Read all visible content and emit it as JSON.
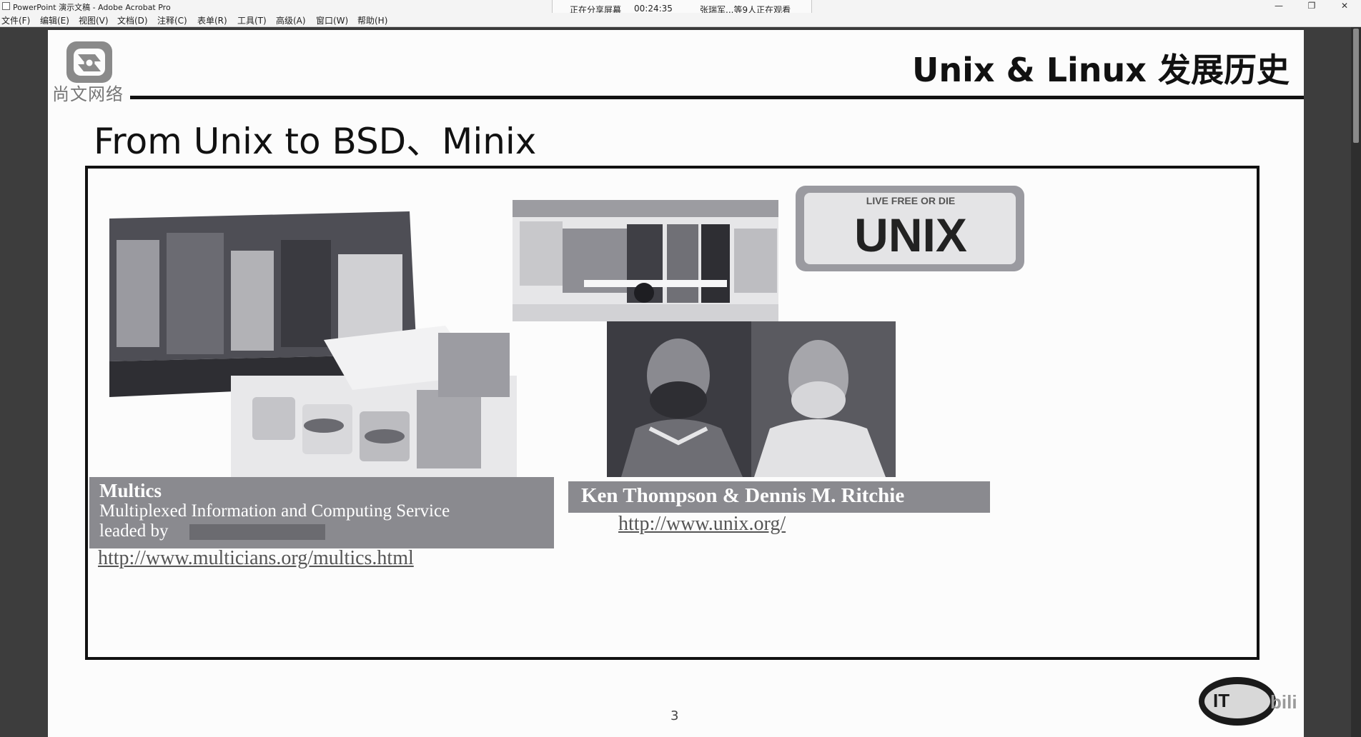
{
  "window": {
    "title": "PowerPoint 演示文稿 - Adobe Acrobat Pro",
    "minimize_icon": "minimize-icon",
    "restore_icon": "restore-icon",
    "close_icon": "close-icon"
  },
  "share_banner": {
    "status": "正在分享屏幕",
    "timer": "00:24:35",
    "viewers": "张瑞军...等9人正在观看"
  },
  "menu": [
    {
      "label": "文件(F)"
    },
    {
      "label": "编辑(E)"
    },
    {
      "label": "视图(V)"
    },
    {
      "label": "文档(D)"
    },
    {
      "label": "注释(C)"
    },
    {
      "label": "表单(R)"
    },
    {
      "label": "工具(T)"
    },
    {
      "label": "高级(A)"
    },
    {
      "label": "窗口(W)"
    },
    {
      "label": "帮助(H)"
    }
  ],
  "slide": {
    "logo_text": "尚文网络",
    "title": "Unix & Linux 发展历史",
    "subtitle": "From Unix to BSD、Minix",
    "left_caption": {
      "line1": "Multics",
      "line2": "Multiplexed Information and Computing Service",
      "line3": "leaded by"
    },
    "left_link": "http://www.multicians.org/multics.html",
    "right_caption": "Ken Thompson & Dennis M. Ritchie",
    "right_link": "http://www.unix.org/",
    "plate": {
      "top_text": "LIVE FREE OR DIE",
      "main_text": "UNIX"
    },
    "page_number": "3"
  },
  "watermark": {
    "left": "IT",
    "right": "bili"
  }
}
